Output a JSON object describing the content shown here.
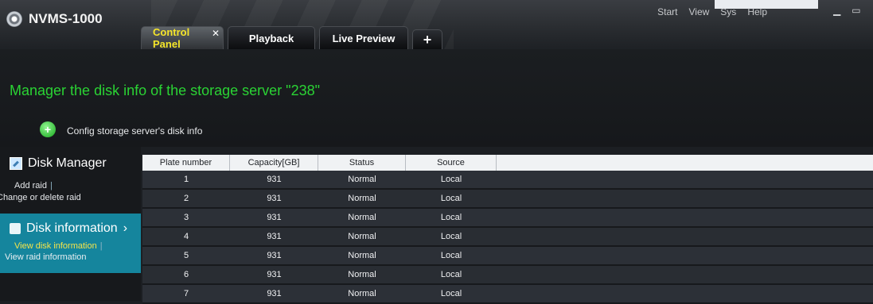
{
  "app": {
    "title": "NVMS-1000"
  },
  "tabs": [
    {
      "label": "Control Panel",
      "active": true
    },
    {
      "label": "Playback"
    },
    {
      "label": "Live Preview"
    }
  ],
  "system_menu": [
    "Start",
    "View",
    "Sys",
    "Help"
  ],
  "header": {
    "title": "Manager the disk info of the storage server \"238\"",
    "subtitle": "Config storage server's disk info"
  },
  "sidebar": {
    "disk_manager": {
      "label": "Disk Manager",
      "links": [
        "Add raid",
        "Change or delete raid"
      ]
    },
    "disk_information": {
      "label": "Disk information",
      "links": [
        "View disk information",
        "View raid information"
      ]
    }
  },
  "table": {
    "columns": [
      "Plate number",
      "Capacity[GB]",
      "Status",
      "Source",
      ""
    ],
    "rows": [
      [
        "1",
        "931",
        "Normal",
        "Local"
      ],
      [
        "2",
        "931",
        "Normal",
        "Local"
      ],
      [
        "3",
        "931",
        "Normal",
        "Local"
      ],
      [
        "4",
        "931",
        "Normal",
        "Local"
      ],
      [
        "5",
        "931",
        "Normal",
        "Local"
      ],
      [
        "6",
        "931",
        "Normal",
        "Local"
      ],
      [
        "7",
        "931",
        "Normal",
        "Local"
      ]
    ]
  },
  "colors": {
    "accent_green": "#2ad334",
    "active_tab_text": "#f6e62a",
    "sidebar_active": "#15859d"
  },
  "icons": {
    "close_tab": "close-icon",
    "add_tab": "plus-icon",
    "brand": "camera-icon"
  }
}
